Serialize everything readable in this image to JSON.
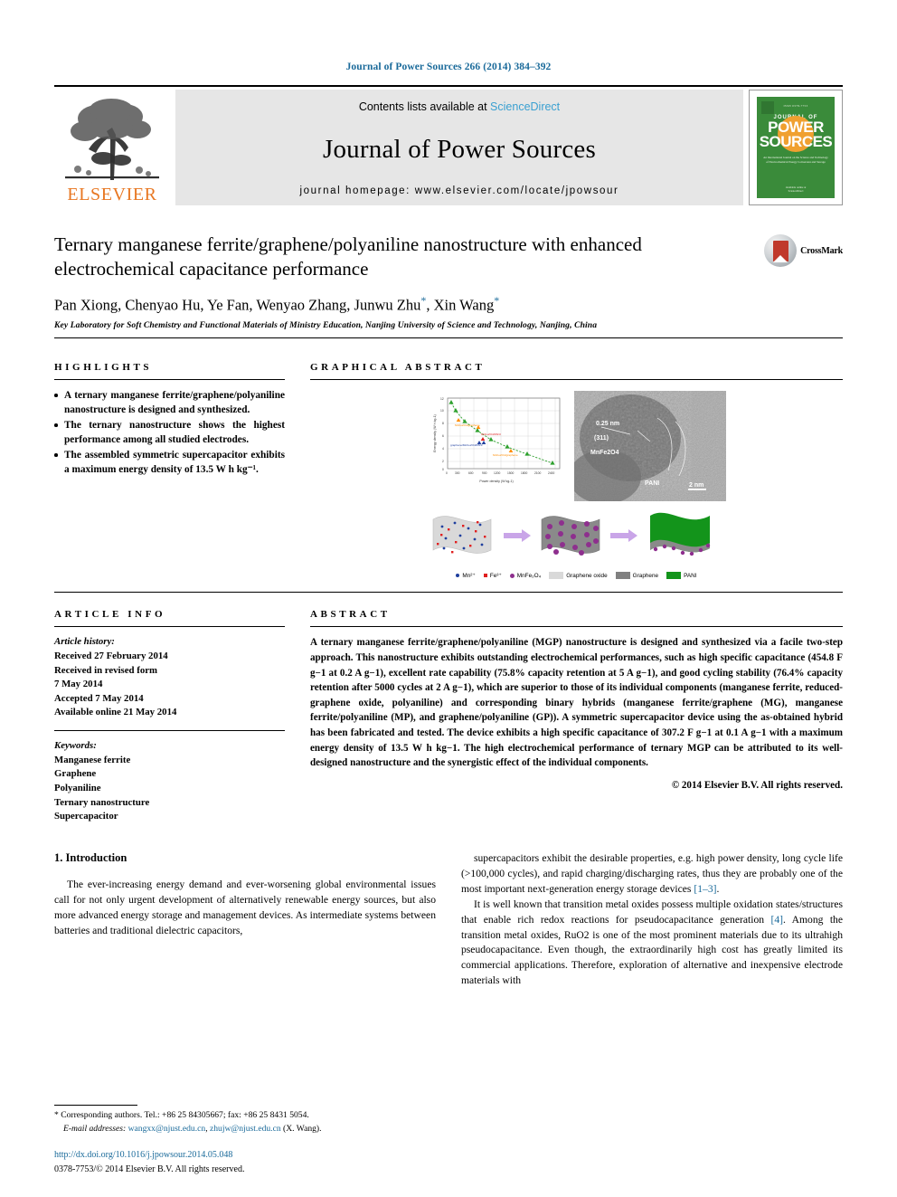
{
  "running_head": "Journal of Power Sources 266 (2014) 384–392",
  "masthead": {
    "publisher": "ELSEVIER",
    "contents_prefix": "Contents lists available at ",
    "contents_link": "ScienceDirect",
    "journal_name": "Journal of Power Sources",
    "homepage": "journal homepage: www.elsevier.com/locate/jpowsour",
    "cover": {
      "line1": "JOURNAL OF",
      "line2": "POWER",
      "line3": "SOURCES",
      "desc": "An International Journal on the Science and Technology of Electrochemical Energy Conversion and Storage",
      "foot": "Available online at\nScienceDirect"
    }
  },
  "article": {
    "title": "Ternary manganese ferrite/graphene/polyaniline nanostructure with enhanced electrochemical capacitance performance",
    "crossmark_label": "CrossMark",
    "authors": "Pan Xiong, Chenyao Hu, Ye Fan, Wenyao Zhang, Junwu Zhu",
    "authors_tail": ", Xin Wang",
    "affiliation": "Key Laboratory for Soft Chemistry and Functional Materials of Ministry Education, Nanjing University of Science and Technology, Nanjing, China"
  },
  "highlights": {
    "heading": "HIGHLIGHTS",
    "items": [
      "A ternary manganese ferrite/graphene/polyaniline nanostructure is designed and synthesized.",
      "The ternary nanostructure shows the highest performance among all studied electrodes.",
      "The assembled symmetric supercapacitor exhibits a maximum energy density of 13.5 W h kg⁻¹."
    ]
  },
  "graphical_abstract": {
    "heading": "GRAPHICAL ABSTRACT",
    "tem_labels": [
      "0.25 nm",
      "(311)",
      "MnFe₂O₄",
      "PANI",
      "2 nm"
    ],
    "legend": [
      {
        "label": "Mn²⁺",
        "color": "#1f3f9e",
        "shape": "dot"
      },
      {
        "label": "Fe³⁺",
        "color": "#e02020",
        "shape": "square"
      },
      {
        "label": "MnFe₂O₄",
        "color": "#8e2f8e",
        "shape": "dot"
      },
      {
        "label": "Graphene oxide",
        "color": "#d9d9d9",
        "shape": "sheet"
      },
      {
        "label": "Graphene",
        "color": "#808080",
        "shape": "sheet"
      },
      {
        "label": "PANI",
        "color": "#13941b",
        "shape": "sheet"
      }
    ]
  },
  "chart_data": {
    "type": "scatter",
    "title": "",
    "xlabel": "Power density (W kg⁻¹)",
    "ylabel": "Energy density (W h kg⁻¹)",
    "xlim": [
      0,
      2400
    ],
    "ylim": [
      0,
      14
    ],
    "xticks": [
      0,
      300,
      600,
      900,
      1200,
      1500,
      1800,
      2100,
      2400
    ],
    "yticks": [
      0,
      2,
      4,
      6,
      8,
      10,
      12
    ],
    "grid": true,
    "legend_position": "inline-annotations",
    "series": [
      {
        "name": "MnFe2O4/graphene/PANI",
        "color": "#2ca02c",
        "x": [
          60,
          160,
          420,
          800,
          1250,
          1750,
          2250
        ],
        "y": [
          13.5,
          11.0,
          8.2,
          6.3,
          4.6,
          3.2,
          1.6
        ]
      },
      {
        "name": "MnFe2O4/graphene",
        "color": "#ff8c00",
        "x": [
          160,
          700
        ],
        "y": [
          9.6,
          7.3
        ]
      },
      {
        "name": "MnFe2O4/PANI",
        "color": "#e02020",
        "x": [
          780
        ],
        "y": [
          5.6
        ]
      },
      {
        "name": "graphene/MnFe2O4/PANI",
        "color": "#1f3f9e",
        "x": [
          700
        ],
        "y": [
          4.8
        ]
      },
      {
        "name": "MnFe2O4/graphene (low)",
        "color": "#ff8c00",
        "x": [
          1230
        ],
        "y": [
          2.9
        ]
      }
    ],
    "annotations": [
      {
        "text": "MnFe₂O₄/graphene",
        "color": "#ff8c00"
      },
      {
        "text": "MnFe₂O₄/PANI",
        "color": "#e02020"
      },
      {
        "text": "graphene/MnFe₂O₄/PANI",
        "color": "#1f3f9e"
      },
      {
        "text": "MnFe₂O₄/graphene",
        "color": "#ff8c00"
      }
    ]
  },
  "article_info": {
    "heading": "ARTICLE INFO",
    "history_label": "Article history:",
    "history": [
      "Received 27 February 2014",
      "Received in revised form",
      "7 May 2014",
      "Accepted 7 May 2014",
      "Available online 21 May 2014"
    ],
    "keywords_label": "Keywords:",
    "keywords": [
      "Manganese ferrite",
      "Graphene",
      "Polyaniline",
      "Ternary nanostructure",
      "Supercapacitor"
    ]
  },
  "abstract": {
    "heading": "ABSTRACT",
    "text": "A ternary manganese ferrite/graphene/polyaniline (MGP) nanostructure is designed and synthesized via a facile two-step approach. This nanostructure exhibits outstanding electrochemical performances, such as high specific capacitance (454.8 F g−1 at 0.2 A g−1), excellent rate capability (75.8% capacity retention at 5 A g−1), and good cycling stability (76.4% capacity retention after 5000 cycles at 2 A g−1), which are superior to those of its individual components (manganese ferrite, reduced-graphene oxide, polyaniline) and corresponding binary hybrids (manganese ferrite/graphene (MG), manganese ferrite/polyaniline (MP), and graphene/polyaniline (GP)). A symmetric supercapacitor device using the as-obtained hybrid has been fabricated and tested. The device exhibits a high specific capacitance of 307.2 F g−1 at 0.1 A g−1 with a maximum energy density of 13.5 W h kg−1. The high electrochemical performance of ternary MGP can be attributed to its well-designed nanostructure and the synergistic effect of the individual components.",
    "copyright": "© 2014 Elsevier B.V. All rights reserved."
  },
  "body": {
    "section_number_title": "1. Introduction",
    "left_paragraph_1": "The ever-increasing energy demand and ever-worsening global environmental issues call for not only urgent development of alternatively renewable energy sources, but also more advanced energy storage and management devices. As intermediate systems between batteries and traditional dielectric capacitors,",
    "right_paragraph_1_a": "supercapacitors exhibit the desirable properties, e.g. high power density, long cycle life (>100,000 cycles), and rapid charging/discharging rates, thus they are probably one of the most important next-generation energy storage devices ",
    "right_paragraph_1_ref": "[1–3]",
    "right_paragraph_1_b": ".",
    "right_paragraph_2_a": "It is well known that transition metal oxides possess multiple oxidation states/structures that enable rich redox reactions for pseudocapacitance generation ",
    "right_paragraph_2_ref": "[4]",
    "right_paragraph_2_b": ". Among the transition metal oxides, RuO2 is one of the most prominent materials due to its ultrahigh pseudocapacitance. Even though, the extraordinarily high cost has greatly limited its commercial applications. Therefore, exploration of alternative and inexpensive electrode materials with"
  },
  "footnote": {
    "star": "*",
    "corresponding": " Corresponding authors. Tel.: +86 25 84305667; fax: +86 25 8431 5054.",
    "email_label": "E-mail addresses:",
    "email1": "wangxx@njust.edu.cn",
    "email_sep": ", ",
    "email2": "zhujw@njust.edu.cn",
    "email_tail": " (X. Wang).",
    "doi": "http://dx.doi.org/10.1016/j.jpowsour.2014.05.048",
    "issn": "0378-7753/© 2014 Elsevier B.V. All rights reserved."
  },
  "colors": {
    "link": "#1a6a9a",
    "sciencedirect": "#3aa0d1",
    "elsevier_orange": "#E87722",
    "cover_green": "#3a8b3a"
  }
}
